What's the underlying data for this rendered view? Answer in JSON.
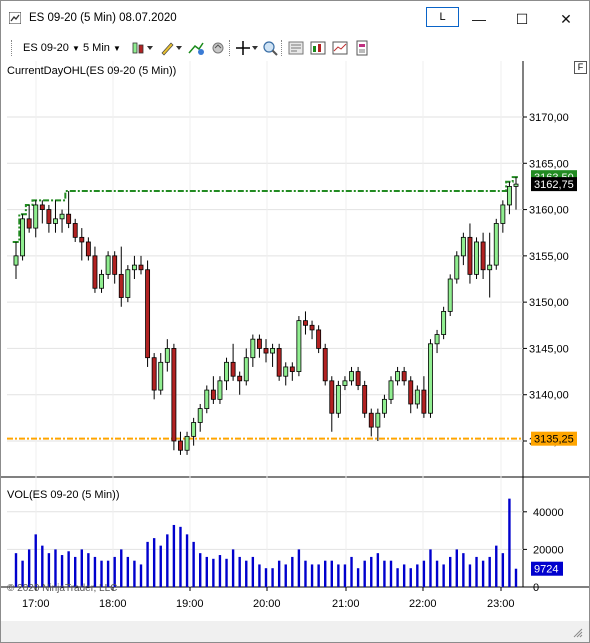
{
  "window": {
    "title": "ES 09-20 (5 Min)  08.07.2020",
    "link_button": "L",
    "minimize_glyph": "—",
    "maximize_glyph": "☐",
    "close_glyph": "✕"
  },
  "toolbar": {
    "instrument": "ES 09-20",
    "interval": "5 Min",
    "icons": [
      "bar-type-icon",
      "drawing-tool-icon",
      "add-indicator-icon",
      "strategy-icon",
      "crosshair-icon",
      "zoom-icon",
      "properties-icon",
      "chart-style-icon",
      "data-box-icon",
      "template-icon"
    ]
  },
  "price_panel": {
    "indicator_label": "CurrentDayOHL(ES 09-20 (5 Min))",
    "y_ticks": [
      "3170,00",
      "3165,00",
      "3160,00",
      "3155,00",
      "3150,00",
      "3145,00",
      "3140,00",
      "3135,00"
    ],
    "current_high_label": "3163,50",
    "last_price_label": "3162,75",
    "current_low_label": "3135,25",
    "f_button": "F"
  },
  "volume_panel": {
    "label": "VOL(ES 09-20 (5 Min))",
    "y_ticks": [
      "40000",
      "20000",
      "0"
    ],
    "last_volume_label": "9724"
  },
  "x_axis": {
    "ticks": [
      "17:00",
      "18:00",
      "19:00",
      "20:00",
      "21:00",
      "22:00",
      "23:00"
    ]
  },
  "copyright": "© 2020 NinjaTrader, LLC",
  "colors": {
    "up_candle": "#90ee90",
    "down_candle": "#b22222",
    "high_line": "#228b22",
    "low_line": "#ffa500",
    "volume_bar": "#0000cd",
    "last_price_bg": "#000000"
  },
  "chart_data": [
    {
      "type": "candlestick",
      "title": "CurrentDayOHL(ES 09-20 (5 Min))",
      "ylim": [
        3132,
        3174
      ],
      "current_day_high": 3163.5,
      "current_day_low": 3135.25,
      "last_price": 3162.75,
      "candles": [
        [
          3154,
          3156.5,
          3152.5,
          3155
        ],
        [
          3155,
          3159.5,
          3154.5,
          3159
        ],
        [
          3159,
          3160.5,
          3157.5,
          3158
        ],
        [
          3158,
          3161,
          3157,
          3160.5
        ],
        [
          3160.5,
          3161,
          3158.5,
          3160
        ],
        [
          3160,
          3160.5,
          3157.5,
          3158.5
        ],
        [
          3158.5,
          3161,
          3157.5,
          3159
        ],
        [
          3159,
          3160,
          3157.5,
          3159.5
        ],
        [
          3159.5,
          3162,
          3158,
          3158.5
        ],
        [
          3158.5,
          3159,
          3156.5,
          3157
        ],
        [
          3157,
          3158,
          3154.5,
          3156.5
        ],
        [
          3156.5,
          3157,
          3154.5,
          3155
        ],
        [
          3155,
          3156,
          3151,
          3151.5
        ],
        [
          3151.5,
          3153.5,
          3151,
          3153
        ],
        [
          3153,
          3155.5,
          3152.5,
          3155
        ],
        [
          3155,
          3155.5,
          3152,
          3153
        ],
        [
          3153,
          3156,
          3149.5,
          3150.5
        ],
        [
          3150.5,
          3154,
          3150,
          3153.5
        ],
        [
          3153.5,
          3155,
          3152.5,
          3154
        ],
        [
          3154,
          3155,
          3153,
          3153.5
        ],
        [
          3153.5,
          3154.5,
          3143,
          3144
        ],
        [
          3144,
          3144.5,
          3139.5,
          3140.5
        ],
        [
          3140.5,
          3144.5,
          3140,
          3143.5
        ],
        [
          3143.5,
          3146,
          3142.5,
          3145
        ],
        [
          3145,
          3145.5,
          3134,
          3135
        ],
        [
          3135,
          3136,
          3133.5,
          3134
        ],
        [
          3134,
          3136,
          3133.5,
          3135.5
        ],
        [
          3135.5,
          3137.5,
          3134.5,
          3137
        ],
        [
          3137,
          3139,
          3136,
          3138.5
        ],
        [
          3138.5,
          3141,
          3138,
          3140.5
        ],
        [
          3140.5,
          3142,
          3139,
          3139.5
        ],
        [
          3139.5,
          3142,
          3139,
          3141.5
        ],
        [
          3141.5,
          3144,
          3140.5,
          3143.5
        ],
        [
          3143.5,
          3145.5,
          3141.5,
          3142
        ],
        [
          3142,
          3142.5,
          3140,
          3141.5
        ],
        [
          3141.5,
          3145,
          3141,
          3144
        ],
        [
          3144,
          3146.5,
          3143,
          3146
        ],
        [
          3146,
          3146.5,
          3144,
          3145
        ],
        [
          3145,
          3146,
          3143.5,
          3144.5
        ],
        [
          3144.5,
          3145.5,
          3143,
          3145
        ],
        [
          3145,
          3145.5,
          3141.5,
          3142
        ],
        [
          3142,
          3143.5,
          3141,
          3143
        ],
        [
          3143,
          3143.5,
          3141.5,
          3142.5
        ],
        [
          3142.5,
          3148.5,
          3142,
          3148
        ],
        [
          3148,
          3149,
          3146.5,
          3147.5
        ],
        [
          3147.5,
          3148,
          3146,
          3147
        ],
        [
          3147,
          3147.5,
          3144.5,
          3145
        ],
        [
          3145,
          3145.5,
          3141,
          3141.5
        ],
        [
          3141.5,
          3142,
          3136,
          3138
        ],
        [
          3138,
          3141.5,
          3137.5,
          3141
        ],
        [
          3141,
          3142,
          3140.5,
          3141.5
        ],
        [
          3141.5,
          3143,
          3141,
          3142.5
        ],
        [
          3142.5,
          3143,
          3140.5,
          3141
        ],
        [
          3141,
          3141.5,
          3137.5,
          3138
        ],
        [
          3138,
          3138.5,
          3135.5,
          3136.5
        ],
        [
          3136.5,
          3138.5,
          3135,
          3138
        ],
        [
          3138,
          3140,
          3137.5,
          3139.5
        ],
        [
          3139.5,
          3142,
          3139,
          3141.5
        ],
        [
          3141.5,
          3143,
          3141,
          3142.5
        ],
        [
          3142.5,
          3143,
          3141,
          3141.5
        ],
        [
          3141.5,
          3142,
          3138,
          3139
        ],
        [
          3139,
          3141,
          3138.5,
          3140.5
        ],
        [
          3140.5,
          3142,
          3137.5,
          3138
        ],
        [
          3138,
          3146,
          3137.5,
          3145.5
        ],
        [
          3145.5,
          3147,
          3144.5,
          3146.5
        ],
        [
          3146.5,
          3149.5,
          3146,
          3149
        ],
        [
          3149,
          3153,
          3148.5,
          3152.5
        ],
        [
          3152.5,
          3155.5,
          3152,
          3155
        ],
        [
          3155,
          3157.5,
          3154,
          3157
        ],
        [
          3157,
          3158.5,
          3152,
          3153
        ],
        [
          3153,
          3157,
          3152.5,
          3156.5
        ],
        [
          3156.5,
          3157.5,
          3152.5,
          3153.5
        ],
        [
          3153.5,
          3157.5,
          3150.5,
          3154
        ],
        [
          3154,
          3159,
          3153.5,
          3158.5
        ],
        [
          3158.5,
          3161,
          3157.5,
          3160.5
        ],
        [
          3160.5,
          3163,
          3159.5,
          3162.5
        ],
        [
          3162.5,
          3163.5,
          3160,
          3162.75
        ]
      ]
    },
    {
      "type": "bar",
      "title": "VOL(ES 09-20 (5 Min))",
      "ylim": [
        0,
        50000
      ],
      "last_volume": 9724,
      "values": [
        18000,
        14000,
        20000,
        28000,
        22000,
        18000,
        20000,
        17000,
        19000,
        16000,
        20000,
        18000,
        16000,
        14000,
        14000,
        16000,
        20000,
        16000,
        14000,
        12000,
        24000,
        26000,
        22000,
        28000,
        33000,
        32000,
        28000,
        24000,
        18000,
        16000,
        15000,
        17000,
        15000,
        20000,
        16000,
        14000,
        16000,
        12000,
        10000,
        10000,
        14000,
        12000,
        16000,
        20000,
        14000,
        12000,
        12000,
        14000,
        14000,
        12000,
        12000,
        16000,
        10000,
        14000,
        16000,
        18000,
        14000,
        14000,
        10000,
        12000,
        10000,
        12000,
        14000,
        20000,
        14000,
        12000,
        16000,
        20000,
        18000,
        12000,
        16000,
        14000,
        16000,
        22000,
        18000,
        47000,
        9724
      ]
    }
  ]
}
